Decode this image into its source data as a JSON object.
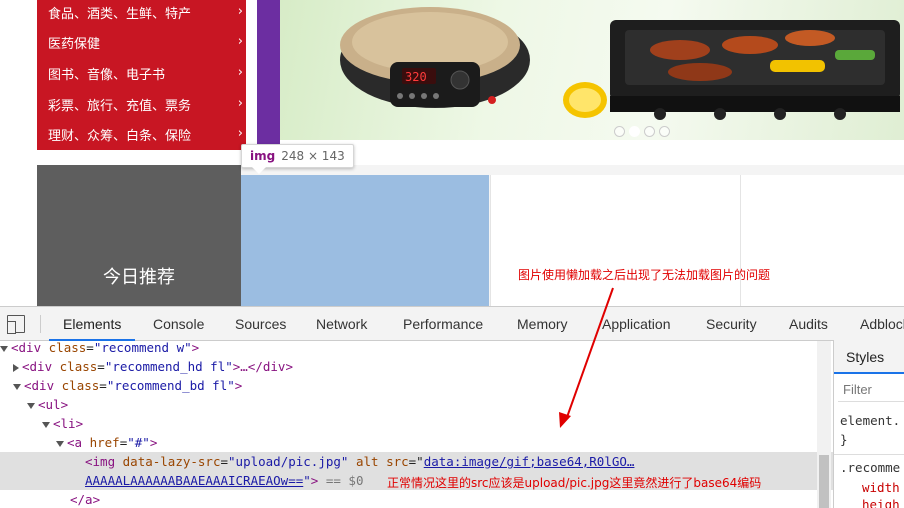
{
  "category_menu": [
    {
      "label": "食品、酒类、生鲜、特产"
    },
    {
      "label": "医药保健"
    },
    {
      "label": "图书、音像、电子书"
    },
    {
      "label": "彩票、旅行、充值、票务"
    },
    {
      "label": "理财、众筹、白条、保险"
    }
  ],
  "chevron": "›",
  "carousel": {
    "dot_count": 4,
    "active_index": 1
  },
  "recommend": {
    "title": "今日推荐"
  },
  "tooltip": {
    "tag": "img",
    "size": "248 × 143"
  },
  "annotation_top": "图片使用懒加载之后出现了无法加载图片的问题",
  "annotation_bottom": "正常情况这里的src应该是upload/pic.jpg这里竟然进行了base64编码",
  "devtools": {
    "tabs": [
      "Elements",
      "Console",
      "Sources",
      "Network",
      "Performance",
      "Memory",
      "Application",
      "Security",
      "Audits",
      "Adblock"
    ],
    "active_tab": "Elements",
    "dom": {
      "l1_tag": "<div",
      "l1_attr": "class",
      "l1_val": "\"recommend w\"",
      "l1_end": ">",
      "l2_tag": "<div",
      "l2_attr": "class",
      "l2_val": "\"recommend_hd fl\"",
      "l2_mid": ">…</",
      "l2_close": "div",
      "l2_end": ">",
      "l3_tag": "<div",
      "l3_attr": "class",
      "l3_val": "\"recommend_bd fl\"",
      "l3_end": ">",
      "l4": "<ul>",
      "l5": "<li>",
      "l6_tag": "<a",
      "l6_attr": "href",
      "l6_val": "\"#\"",
      "l6_end": ">",
      "l7_tag": "<img",
      "l7_attr1": "data-lazy-src",
      "l7_val1": "\"upload/pic.jpg\"",
      "l7_attr2": "alt",
      "l7_attr3": "src",
      "l7_link1": "data:image/gif;base64,R0lGO…",
      "l8_link2": "AAAAALAAAAAABAAEAAAICRAEAOw==",
      "l8_quote": "\"",
      "l8_end": ">",
      "l8_eq": " == $0",
      "l9": "</a>"
    },
    "styles": {
      "tab": "Styles",
      "filter_placeholder": "Filter",
      "rule1": "element.",
      "rule1_close": "}",
      "rule2": ".recomme",
      "prop1": "width",
      "prop2": "heigh"
    }
  }
}
